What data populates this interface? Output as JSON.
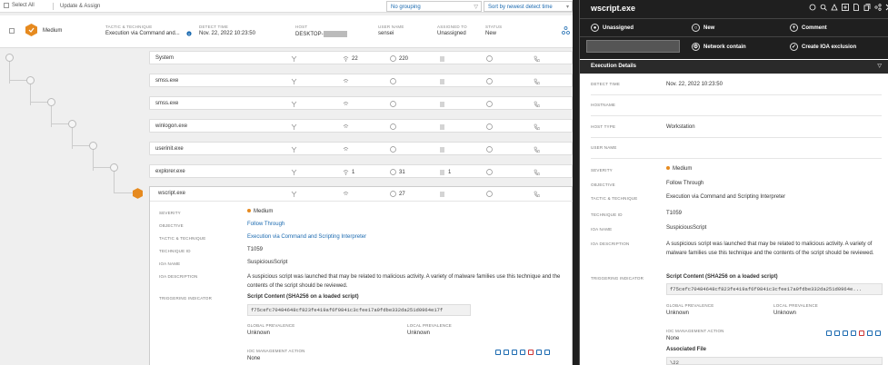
{
  "toolbar": {
    "select_all": "Select All",
    "update_assign": "Update & Assign",
    "grouping": "No grouping",
    "sort": "Sort by newest detect time"
  },
  "alert": {
    "severity": "Medium",
    "tactic_label": "TACTIC & TECHNIQUE",
    "tactic_value": "Execution via Command and...",
    "detect_label": "DETECT TIME",
    "detect_value": "Nov. 22, 2022 10:23:50",
    "host_label": "HOST",
    "host_value": "DESKTOP-",
    "user_label": "USER NAME",
    "user_value": "sensei",
    "assigned_label": "ASSIGNED TO",
    "assigned_value": "Unassigned",
    "status_label": "STATUS",
    "status_value": "New"
  },
  "tree": [
    {
      "name": "System",
      "c1": "22",
      "c2": "220"
    },
    {
      "name": "smss.exe"
    },
    {
      "name": "smss.exe"
    },
    {
      "name": "winlogon.exe"
    },
    {
      "name": "userinit.exe"
    },
    {
      "name": "explorer.exe",
      "c1": "1",
      "c2": "31",
      "c3": "1"
    },
    {
      "name": "wscript.exe",
      "c2": "27"
    }
  ],
  "detail": {
    "severity_label": "SEVERITY",
    "severity_value": "Medium",
    "objective_label": "OBJECTIVE",
    "objective_value": "Follow Through",
    "tactic_label": "TACTIC & TECHNIQUE",
    "tactic_value": "Execution via Command and Scripting Interpreter",
    "technique_label": "TECHNIQUE ID",
    "technique_value": "T1059",
    "ioa_name_label": "IOA NAME",
    "ioa_name_value": "SuspiciousScript",
    "ioa_desc_label": "IOA DESCRIPTION",
    "ioa_desc_value": "A suspicious script was launched that may be related to malicious activity. A variety of malware families use this technique and the contents of the script should be reviewed.",
    "trigger_label": "TRIGGERING INDICATOR",
    "script_title": "Script Content (SHA256 on a loaded script)",
    "hash": "f75cefc70484648cf823fe419af6f9841c3cfee17a9fdbe332da251d0964e17f",
    "global_prev_label": "GLOBAL PREVALENCE",
    "global_prev_value": "Unknown",
    "local_prev_label": "LOCAL PREVALENCE",
    "local_prev_value": "Unknown",
    "ioc_label": "IOC MANAGEMENT ACTION",
    "ioc_value": "None"
  },
  "panel": {
    "title": "wscript.exe",
    "unassigned": "Unassigned",
    "new": "New",
    "comment": "Comment",
    "network_contain": "Network contain",
    "create_ioa": "Create IOA exclusion",
    "exec_details": "Execution Details",
    "detect_label": "DETECT TIME",
    "detect_value": "Nov. 22, 2022 10:23:50",
    "hostname_label": "HOSTNAME",
    "hosttype_label": "HOST TYPE",
    "hosttype_value": "Workstation",
    "username_label": "USER NAME",
    "severity_label": "SEVERITY",
    "severity_value": "Medium",
    "objective_label": "OBJECTIVE",
    "objective_value": "Follow Through",
    "tactic_label": "TACTIC & TECHNIQUE",
    "tactic_value": "Execution via Command and Scripting Interpreter",
    "technique_label": "TECHNIQUE ID",
    "technique_value": "T1059",
    "ioa_name_label": "IOA NAME",
    "ioa_name_value": "SuspiciousScript",
    "ioa_desc_label": "IOA DESCRIPTION",
    "ioa_desc_value": "A suspicious script was launched that may be related to malicious activity. A variety of malware families use this technique and the contents of the script should be reviewed.",
    "trigger_label": "TRIGGERING INDICATOR",
    "script_title": "Script Content (SHA256 on a loaded script)",
    "hash": "f75cefc70484648cf823fe419af6f9841c3cfee17a9fdbe332da251d0964e...",
    "global_prev_label": "GLOBAL PREVALENCE",
    "global_prev_value": "Unknown",
    "local_prev_label": "LOCAL PREVALENCE",
    "local_prev_value": "Unknown",
    "ioc_label": "IOC MANAGEMENT ACTION",
    "ioc_value": "None",
    "assoc_file": "Associated File",
    "assoc_value": "\\22"
  },
  "colors": {
    "accent": "#1b6ab0",
    "severity": "#e68a1f",
    "dark": "#1f1f1f"
  }
}
